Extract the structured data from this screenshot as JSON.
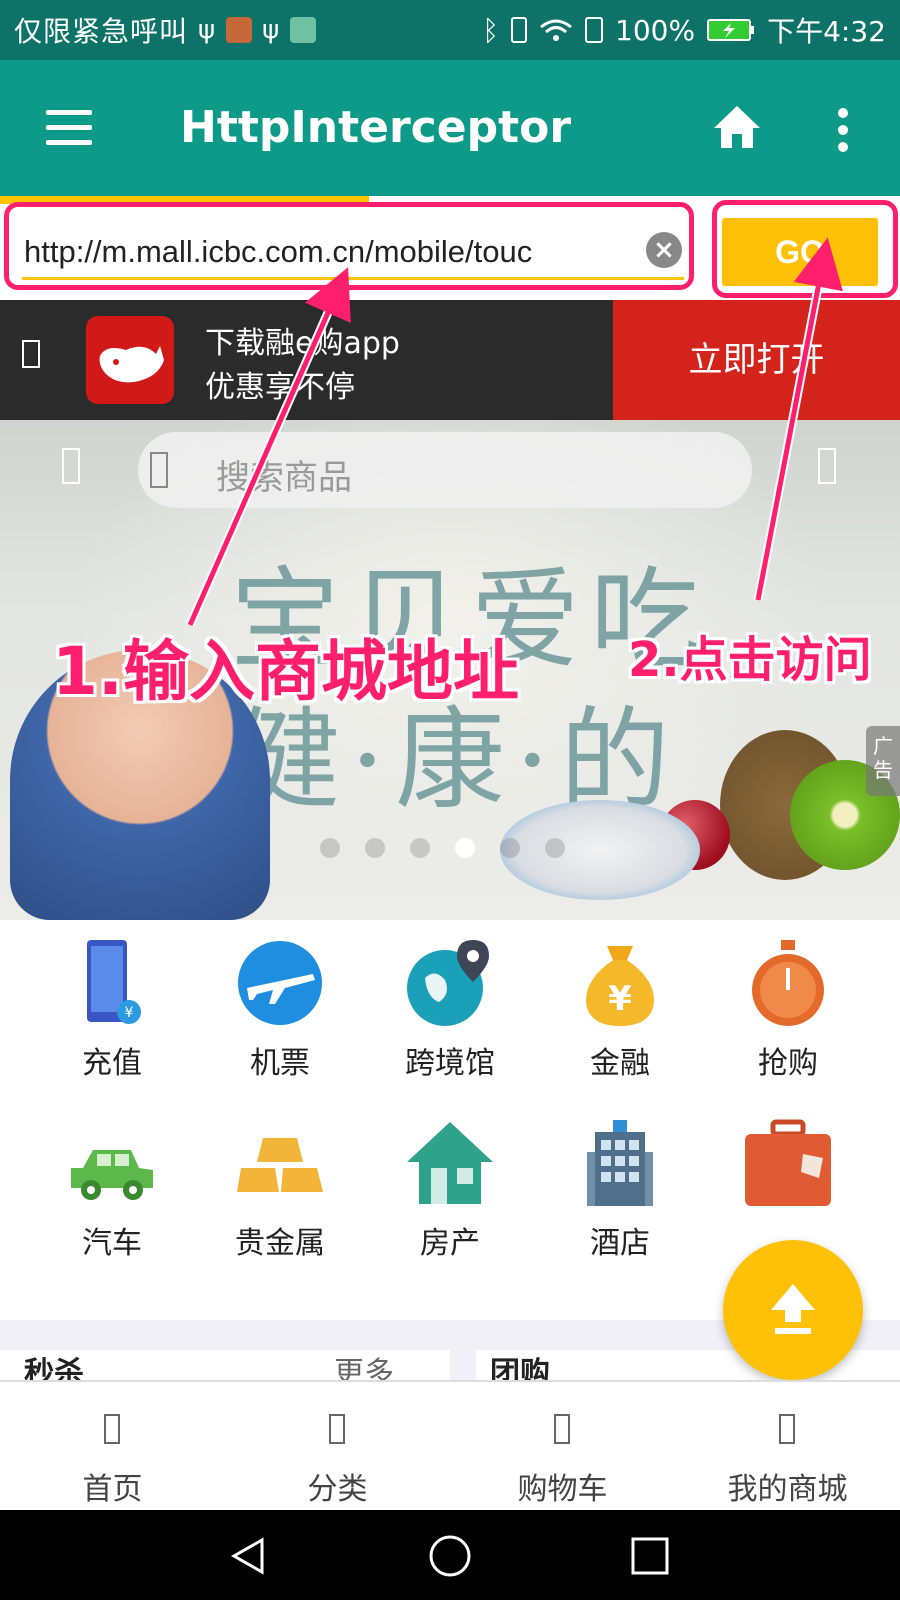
{
  "status_bar": {
    "carrier_text": "仅限紧急呼叫",
    "battery_percent": "100%",
    "time": "下午4:32",
    "icons": [
      "usb-icon",
      "app-notification-icon",
      "usb-icon",
      "huawei-icon",
      "bluetooth-icon",
      "vibrate-icon",
      "wifi-icon",
      "battery-saver-icon",
      "battery-charging-icon"
    ]
  },
  "app_bar": {
    "title": "HttpInterceptor",
    "menu_icon": "hamburger-menu-icon",
    "home_icon": "home-icon",
    "overflow_icon": "more-vert-icon"
  },
  "page_load_progress": 0.41,
  "url_bar": {
    "value": "http://m.mall.icbc.com.cn/mobile/touc",
    "clear_icon": "clear-icon",
    "go_label": "GO"
  },
  "app_banner": {
    "line1": "下载融e购app",
    "line2": "优惠享不停",
    "open_label": "立即打开"
  },
  "hero": {
    "search_placeholder": "搜索商品",
    "text_line1": "宝贝爱吃",
    "text_line2": "健·康·的",
    "ad_tag": "广告",
    "carousel": {
      "total": 6,
      "active_index": 3
    }
  },
  "annotations": {
    "step1": "1.输入商城地址",
    "step2": "2.点击访问"
  },
  "categories": [
    {
      "label": "充值",
      "icon": "phone-recharge-icon"
    },
    {
      "label": "机票",
      "icon": "airplane-icon"
    },
    {
      "label": "跨境馆",
      "icon": "globe-location-icon"
    },
    {
      "label": "金融",
      "icon": "money-bag-icon"
    },
    {
      "label": "抢购",
      "icon": "stopwatch-icon"
    },
    {
      "label": "汽车",
      "icon": "car-icon"
    },
    {
      "label": "贵金属",
      "icon": "gold-bars-icon"
    },
    {
      "label": "房产",
      "icon": "house-icon"
    },
    {
      "label": "酒店",
      "icon": "hotel-icon"
    },
    {
      "label": "",
      "icon": "suitcase-icon"
    }
  ],
  "cards": {
    "left_title": "秒杀",
    "left_more": "更多",
    "right_title": "团购"
  },
  "fab_icon": "upload-arrow-icon",
  "bottom_nav": [
    {
      "label": "首页"
    },
    {
      "label": "分类"
    },
    {
      "label": "购物车"
    },
    {
      "label": "我的商城"
    }
  ],
  "system_nav": [
    "back-icon",
    "home-circle-icon",
    "recents-icon"
  ],
  "colors": {
    "app_bar": "#0e9a89",
    "status_bar": "#0d7268",
    "accent": "#ffc107",
    "highlight": "#ff1f6d",
    "banner_red": "#d4231b"
  }
}
